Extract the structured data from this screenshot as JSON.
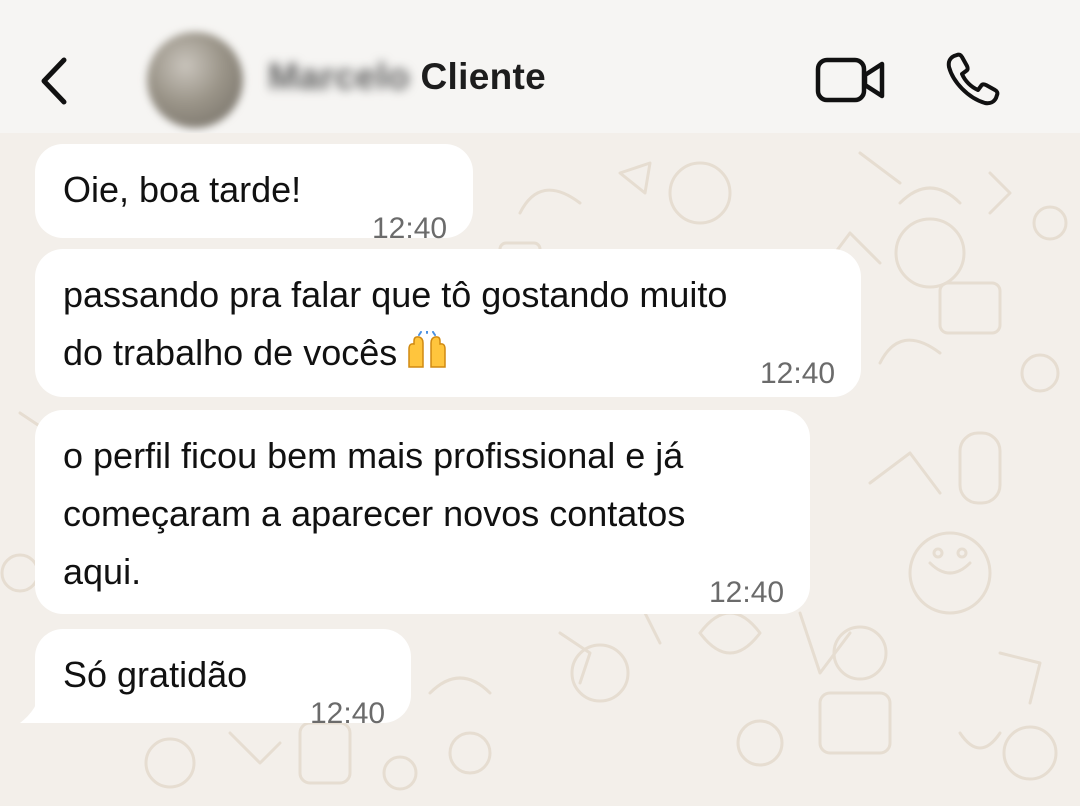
{
  "header": {
    "contact_name_blurred": "Marcelo",
    "contact_name_visible": "Cliente"
  },
  "icons": {
    "back": "chevron-left-icon",
    "video": "video-camera-icon",
    "call": "phone-icon",
    "emoji": "raising-hands-emoji"
  },
  "messages": [
    {
      "text": "Oie, boa tarde!",
      "time": "12:40"
    },
    {
      "line1": "passando pra falar que tô gostando muito",
      "line2": "do trabalho de vocês",
      "time": "12:40"
    },
    {
      "line1": "o perfil ficou bem mais profissional e já",
      "line2": "começaram a aparecer novos contatos",
      "line3": "aqui.",
      "time": "12:40"
    },
    {
      "text": "Só gratidão",
      "time": "12:40"
    }
  ],
  "colors": {
    "header_bg": "#f6f5f3",
    "chat_bg": "#f3efea",
    "bubble_bg": "#ffffff",
    "timestamp": "#6b6b6b"
  }
}
